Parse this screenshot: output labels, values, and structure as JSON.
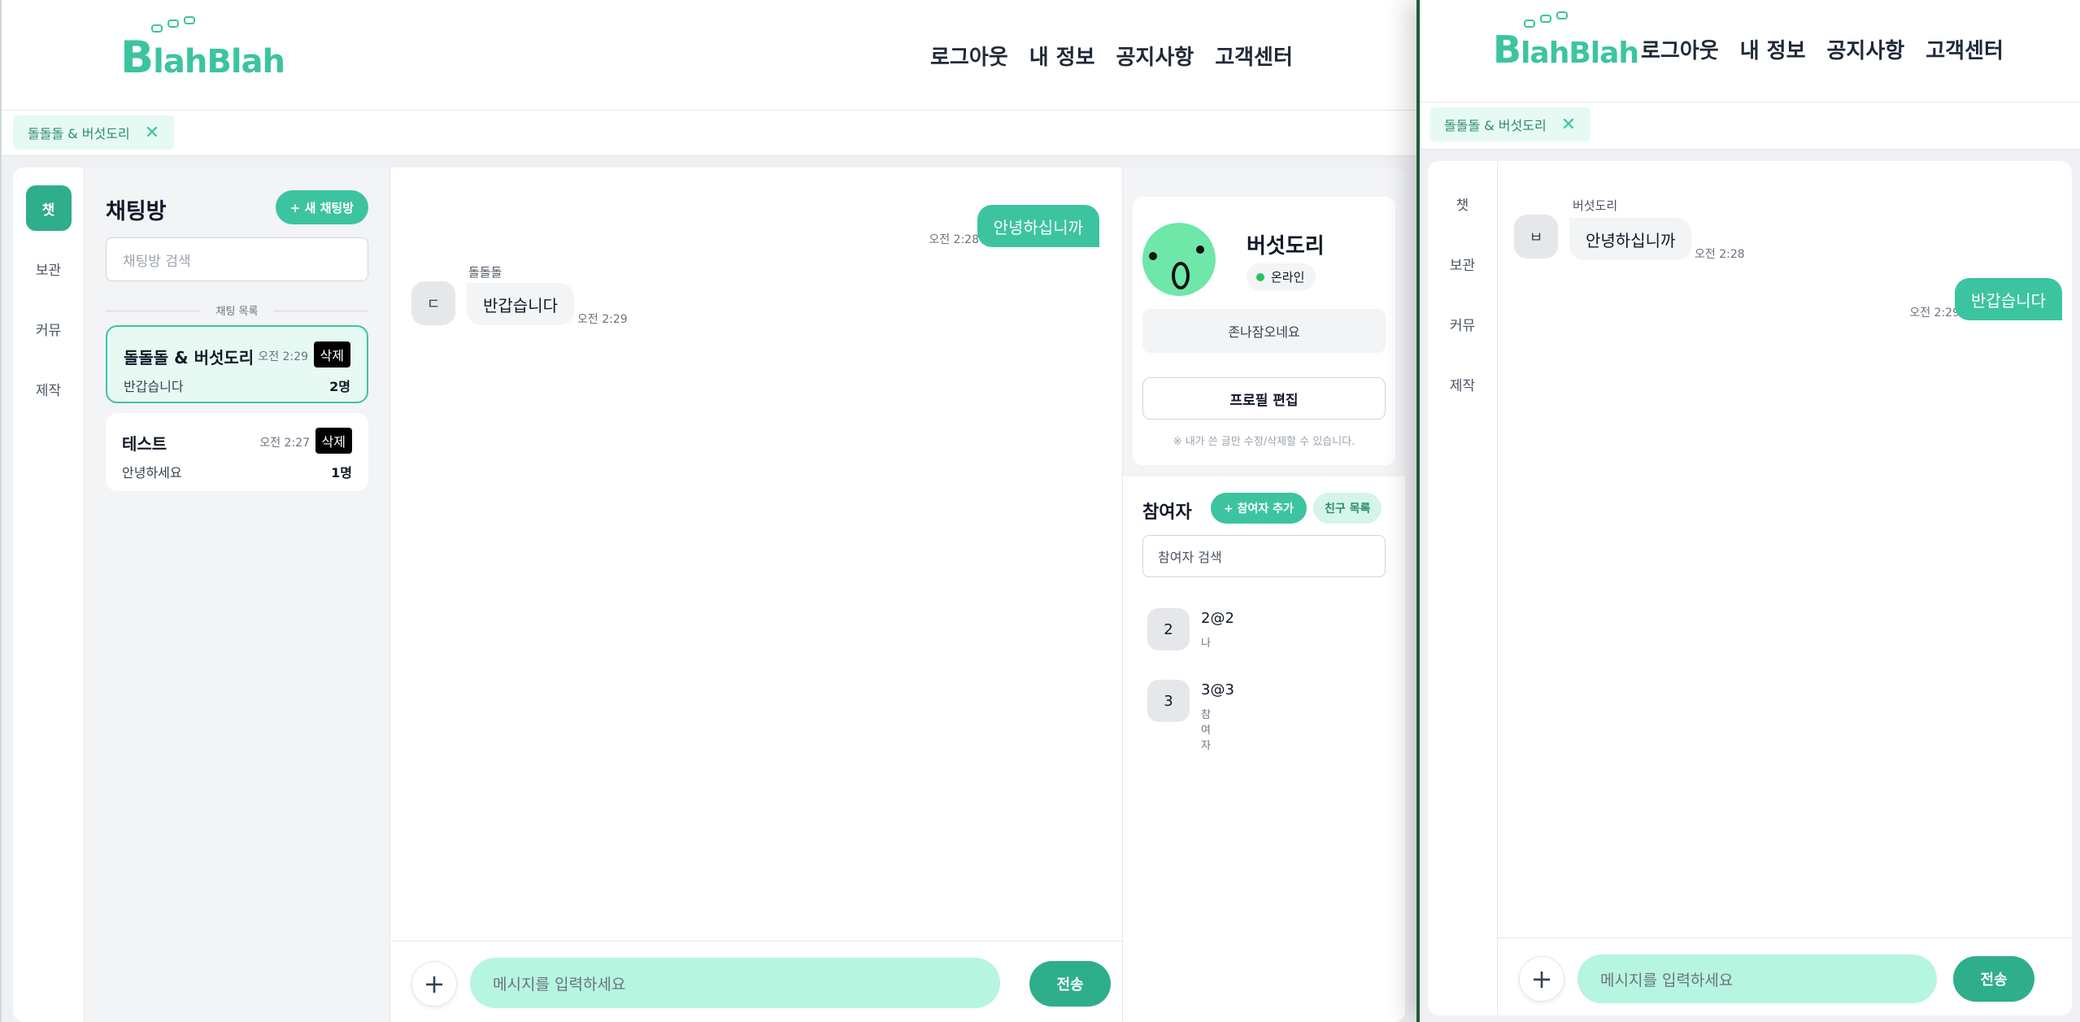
{
  "brand": {
    "logo_b": "B",
    "logo_rest": "lahBlah"
  },
  "nav": [
    "로그아웃",
    "내 정보",
    "공지사항",
    "고객센터"
  ],
  "tab": {
    "label": "돌돌돌 & 버섯도리",
    "close": "✕"
  },
  "rail": [
    "챗",
    "보관",
    "커뮤",
    "제작"
  ],
  "rooms_panel": {
    "title": "채팅방",
    "new_room": "+ 새 채팅방",
    "search_placeholder": "채팅방 검색",
    "divider": "채팅 목록",
    "rooms": [
      {
        "name": "돌돌돌 & 버섯도리",
        "time": "오전 2:29",
        "delete": "삭제",
        "last": "반갑습니다",
        "count": "2명"
      },
      {
        "name": "테스트",
        "time": "오전 2:27",
        "delete": "삭제",
        "last": "안녕하세요",
        "count": "1명"
      }
    ]
  },
  "left_chat": {
    "mine": {
      "text": "안녕하십니까",
      "time": "오전 2:28"
    },
    "other": {
      "sender": "돌돌돌",
      "avatar": "ㄷ",
      "text": "반갑습니다",
      "time": "오전 2:29"
    }
  },
  "composer": {
    "plus": "+",
    "placeholder": "메시지를 입력하세요",
    "send": "전송"
  },
  "profile": {
    "name": "버섯도리",
    "status": "온라인",
    "message": "존나잠오네요",
    "edit": "프로필 편집",
    "note": "※ 내가 쓴 글만 수정/삭제할 수 있습니다."
  },
  "participants": {
    "title": "참여자",
    "add": "+ 참여자 추가",
    "friends": "친구 목록",
    "search_placeholder": "참여자 검색",
    "list": [
      {
        "avatar": "2",
        "name": "2@2",
        "role": "나"
      },
      {
        "avatar": "3",
        "name": "3@3",
        "role": "참여자"
      }
    ]
  },
  "right_chat": {
    "other": {
      "sender": "버섯도리",
      "avatar": "ㅂ",
      "text": "안녕하십니까",
      "time": "오전 2:28"
    },
    "mine": {
      "text": "반갑습니다",
      "time": "오전 2:29"
    }
  },
  "colors": {
    "accent": "#3cc4a0",
    "accent_dark": "#2fae8c",
    "input_bg": "#b6f5df",
    "tab_bg": "#e6faf3"
  }
}
